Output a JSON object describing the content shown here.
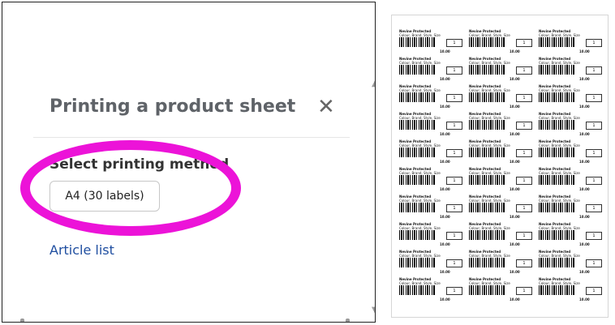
{
  "dialog": {
    "title": "Printing a product sheet",
    "close_icon": "close-icon",
    "section_label": "Select printing method",
    "select_value": "A4 (30 labels)",
    "link_text": "Article list"
  },
  "annotation": {
    "color": "#ec13d8"
  },
  "preview": {
    "labels": [
      {
        "name": "Nevine Protected",
        "desc": "Colour, Brand, Style, Size",
        "qty": "1",
        "price": "10.00"
      },
      {
        "name": "Nevine Protected",
        "desc": "Colour, Brand, Style, Size",
        "qty": "1",
        "price": "10.00"
      },
      {
        "name": "Nevine Protected",
        "desc": "Colour, Brand, Style, Size",
        "qty": "1",
        "price": "10.00"
      },
      {
        "name": "Nevine Protected",
        "desc": "Colour, Brand, Style, Size",
        "qty": "1",
        "price": "10.00"
      },
      {
        "name": "Nevine Protected",
        "desc": "Colour, Brand, Style, Size",
        "qty": "1",
        "price": "10.00"
      },
      {
        "name": "Nevine Protected",
        "desc": "Colour, Brand, Style, Size",
        "qty": "1",
        "price": "10.00"
      },
      {
        "name": "Nevine Protected",
        "desc": "Colour, Brand, Style, Size",
        "qty": "1",
        "price": "10.00"
      },
      {
        "name": "Nevine Protected",
        "desc": "Colour, Brand, Style, Size",
        "qty": "1",
        "price": "10.00"
      },
      {
        "name": "Nevine Protected",
        "desc": "Colour, Brand, Style, Size",
        "qty": "1",
        "price": "10.00"
      },
      {
        "name": "Nevine Protected",
        "desc": "Colour, Brand, Style, Size",
        "qty": "1",
        "price": "10.00"
      },
      {
        "name": "Nevine Protected",
        "desc": "Colour, Brand, Style, Size",
        "qty": "1",
        "price": "10.00"
      },
      {
        "name": "Nevine Protected",
        "desc": "Colour, Brand, Style, Size",
        "qty": "1",
        "price": "10.00"
      },
      {
        "name": "Nevine Protected",
        "desc": "Colour, Brand, Style, Size",
        "qty": "1",
        "price": "10.00"
      },
      {
        "name": "Nevine Protected",
        "desc": "Colour, Brand, Style, Size",
        "qty": "1",
        "price": "10.00"
      },
      {
        "name": "Nevine Protected",
        "desc": "Colour, Brand, Style, Size",
        "qty": "1",
        "price": "10.00"
      },
      {
        "name": "Nevine Protected",
        "desc": "Colour, Brand, Style, Size",
        "qty": "1",
        "price": "10.00"
      },
      {
        "name": "Nevine Protected",
        "desc": "Colour, Brand, Style, Size",
        "qty": "1",
        "price": "10.00"
      },
      {
        "name": "Nevine Protected",
        "desc": "Colour, Brand, Style, Size",
        "qty": "1",
        "price": "10.00"
      },
      {
        "name": "Nevine Protected",
        "desc": "Colour, Brand, Style, Size",
        "qty": "1",
        "price": "10.00"
      },
      {
        "name": "Nevine Protected",
        "desc": "Colour, Brand, Style, Size",
        "qty": "1",
        "price": "10.00"
      },
      {
        "name": "Nevine Protected",
        "desc": "Colour, Brand, Style, Size",
        "qty": "1",
        "price": "10.00"
      },
      {
        "name": "Nevine Protected",
        "desc": "Colour, Brand, Style, Size",
        "qty": "1",
        "price": "10.00"
      },
      {
        "name": "Nevine Protected",
        "desc": "Colour, Brand, Style, Size",
        "qty": "1",
        "price": "10.00"
      },
      {
        "name": "Nevine Protected",
        "desc": "Colour, Brand, Style, Size",
        "qty": "1",
        "price": "10.00"
      },
      {
        "name": "Nevine Protected",
        "desc": "Colour, Brand, Style, Size",
        "qty": "1",
        "price": "10.00"
      },
      {
        "name": "Nevine Protected",
        "desc": "Colour, Brand, Style, Size",
        "qty": "1",
        "price": "10.00"
      },
      {
        "name": "Nevine Protected",
        "desc": "Colour, Brand, Style, Size",
        "qty": "1",
        "price": "10.00"
      },
      {
        "name": "Nevine Protected",
        "desc": "Colour, Brand, Style, Size",
        "qty": "1",
        "price": "10.00"
      },
      {
        "name": "Nevine Protected",
        "desc": "Colour, Brand, Style, Size",
        "qty": "1",
        "price": "10.00"
      },
      {
        "name": "Nevine Protected",
        "desc": "Colour, Brand, Style, Size",
        "qty": "1",
        "price": "10.00"
      }
    ]
  }
}
